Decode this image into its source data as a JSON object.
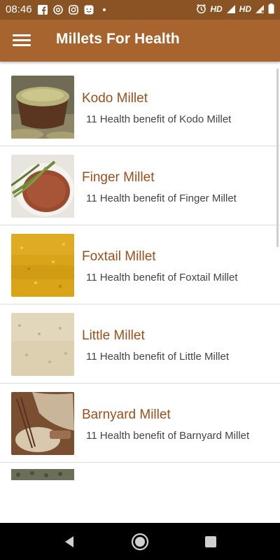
{
  "status_bar": {
    "time": "08:46",
    "left_icons": [
      "facebook-icon",
      "at-sign-icon",
      "instagram-icon",
      "chat-icon",
      "dot-icon"
    ],
    "right_icons": [
      "alarm-icon",
      "signal-icon",
      "signal-icon",
      "battery-icon"
    ],
    "hd1": "HD",
    "hd2": "HD"
  },
  "app_bar": {
    "title": "Millets For Health",
    "menu_icon": "hamburger-menu-icon"
  },
  "colors": {
    "status_bar": "#8a5324",
    "app_bar": "#a7642e",
    "item_title": "#9a4f1c",
    "item_subtitle": "#444444"
  },
  "items": [
    {
      "title": "Kodo Millet",
      "subtitle": "11 Health benefit of  Kodo Millet",
      "image": "kodo-millet-image"
    },
    {
      "title": "Finger Millet",
      "subtitle": "11 Health benefit of  Finger Millet",
      "image": "finger-millet-image"
    },
    {
      "title": "Foxtail Millet",
      "subtitle": "11 Health benefit of  Foxtail Millet",
      "image": "foxtail-millet-image"
    },
    {
      "title": "Little Millet",
      "subtitle": "11 Health benefit of  Little Millet",
      "image": "little-millet-image"
    },
    {
      "title": "Barnyard Millet",
      "subtitle": "11 Health benefit of  Barnyard Millet",
      "image": "barnyard-millet-image"
    }
  ],
  "nav_bar": {
    "icons": [
      "back-icon",
      "home-icon",
      "recents-icon"
    ]
  }
}
